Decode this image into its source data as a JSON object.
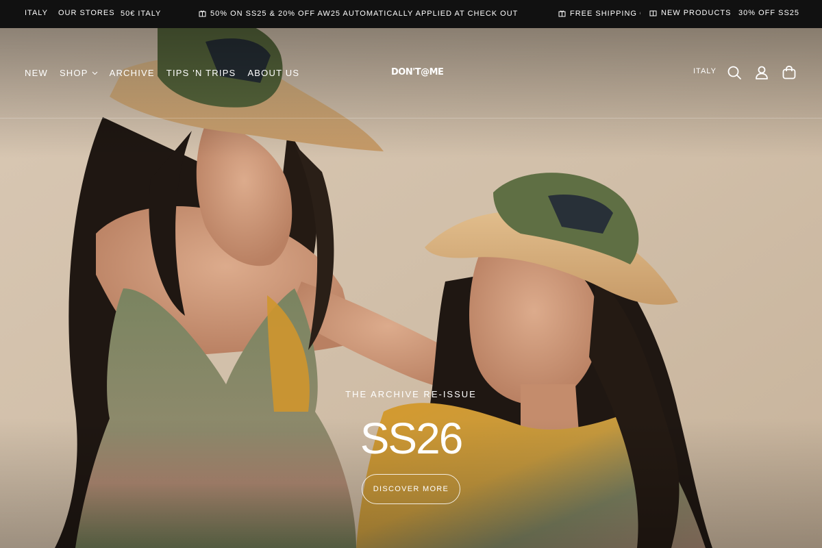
{
  "announcement": {
    "country": "ITALY",
    "stores": "OUR STORES",
    "shipping_threshold": "50€ ITALY",
    "promo": "50% ON SS25 & 20% OFF AW25 AUTOMATICALLY APPLIED AT CHECK OUT",
    "free_shipping": "FREE SHIPPING O",
    "new_products": "NEW PRODUCTS",
    "ss25_offer": "30% OFF SS25",
    "icon": "gift-box-icon"
  },
  "header": {
    "nav": [
      {
        "label": "NEW"
      },
      {
        "label": "SHOP",
        "icon": "chevron-down-icon"
      },
      {
        "label": "ARCHIVE"
      },
      {
        "label": "TIPS 'N TRIPS"
      },
      {
        "label": "ABOUT US"
      }
    ],
    "logo": "DON'T@ME",
    "country": "ITALY",
    "icons": [
      "search-icon",
      "account-icon",
      "cart-icon"
    ]
  },
  "hero": {
    "eyebrow": "THE ARCHIVE RE-ISSUE",
    "headline": "SS26",
    "cta": "DISCOVER MORE",
    "image": "two-women-in-straw-hats-photo"
  },
  "colors": {
    "topbar_bg": "#111111",
    "text": "#ffffff",
    "backdrop": "#d7c6b2",
    "hair": "#1f1712",
    "olive": "#6f7a55",
    "mustard": "#d59a2e"
  }
}
